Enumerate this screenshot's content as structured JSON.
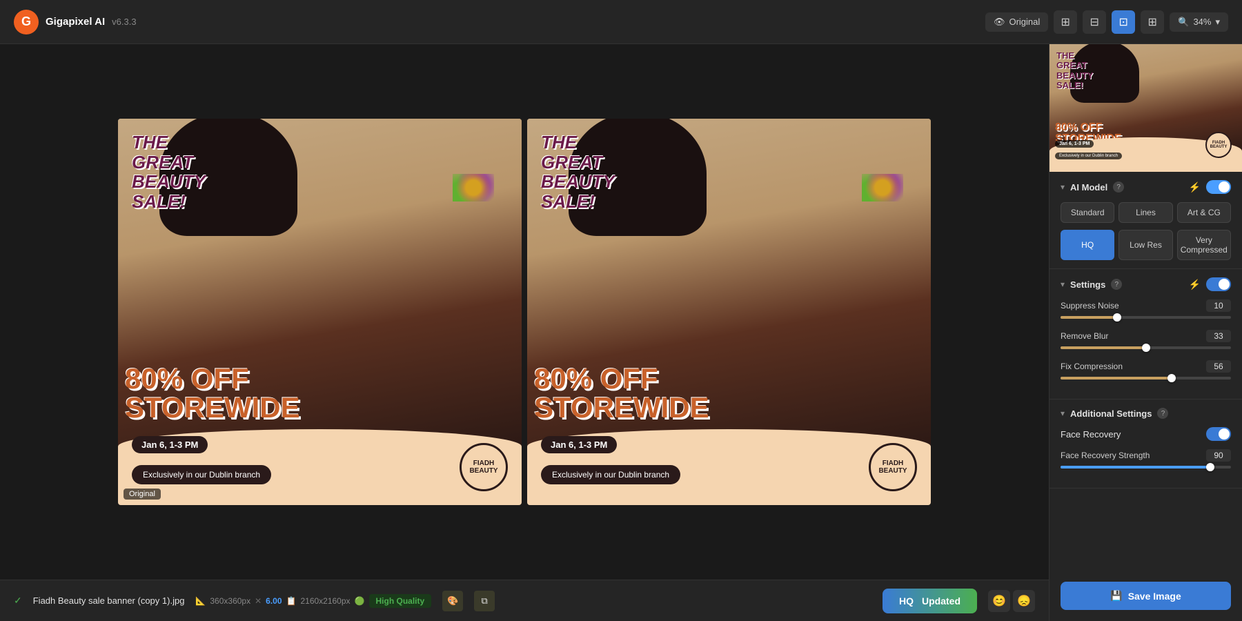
{
  "app": {
    "name": "Gigapixel AI",
    "version": "v6.3.3",
    "logo": "G"
  },
  "topbar": {
    "original_btn": "Original",
    "zoom_btn": "34%",
    "zoom_icon": "🔍"
  },
  "view_icons": {
    "grid1": "⊞",
    "grid2": "⊟",
    "split": "⊟",
    "compare": "⊞"
  },
  "panels": {
    "left_label": "Original",
    "ad": {
      "title_line1": "THE",
      "title_line2": "GREAT",
      "title_line3": "BEAUTY",
      "title_line4": "SALE!",
      "discount": "80% OFF",
      "storewide": "STOREWIDE",
      "date": "Jan 6, 1-3 PM",
      "branch": "Exclusively in our Dublin branch",
      "logo": "FIADH BEAUTY"
    }
  },
  "right_panel": {
    "thumbnail_alt": "Thumbnail preview",
    "ai_model": {
      "section_title": "AI Model",
      "help": "?",
      "tabs": [
        "Standard",
        "Lines",
        "Art & CG"
      ],
      "quality_tabs": [
        "HQ",
        "Low Res",
        "Very Compressed"
      ],
      "active_quality": "HQ"
    },
    "settings": {
      "section_title": "Settings",
      "help": "?",
      "suppress_noise_label": "Suppress Noise",
      "suppress_noise_value": "10",
      "suppress_noise_pct": 33,
      "remove_blur_label": "Remove Blur",
      "remove_blur_value": "33",
      "remove_blur_pct": 50,
      "fix_compression_label": "Fix Compression",
      "fix_compression_value": "56",
      "fix_compression_pct": 65
    },
    "additional_settings": {
      "section_title": "Additional Settings",
      "help": "?",
      "face_recovery_label": "Face Recovery",
      "face_recovery_enabled": true,
      "face_recovery_strength_label": "Face Recovery Strength",
      "face_recovery_strength_value": "90",
      "face_recovery_strength_pct": 88
    },
    "save_btn_label": "Save Image",
    "save_icon": "💾"
  },
  "bottom_bar": {
    "check_icon": "✓",
    "file_name": "Fiadh Beauty sale banner (copy 1).jpg",
    "original_size_icon": "📐",
    "original_size": "360x360px",
    "scale_icon": "✕",
    "scale": "6.00",
    "output_size_icon": "📋",
    "output_size": "2160x2160px",
    "quality_icon": "🟢",
    "quality_label": "High Quality",
    "hq_label": "HQ",
    "updated_label": "Updated",
    "emoji_happy": "😊",
    "emoji_sad": "😞"
  }
}
